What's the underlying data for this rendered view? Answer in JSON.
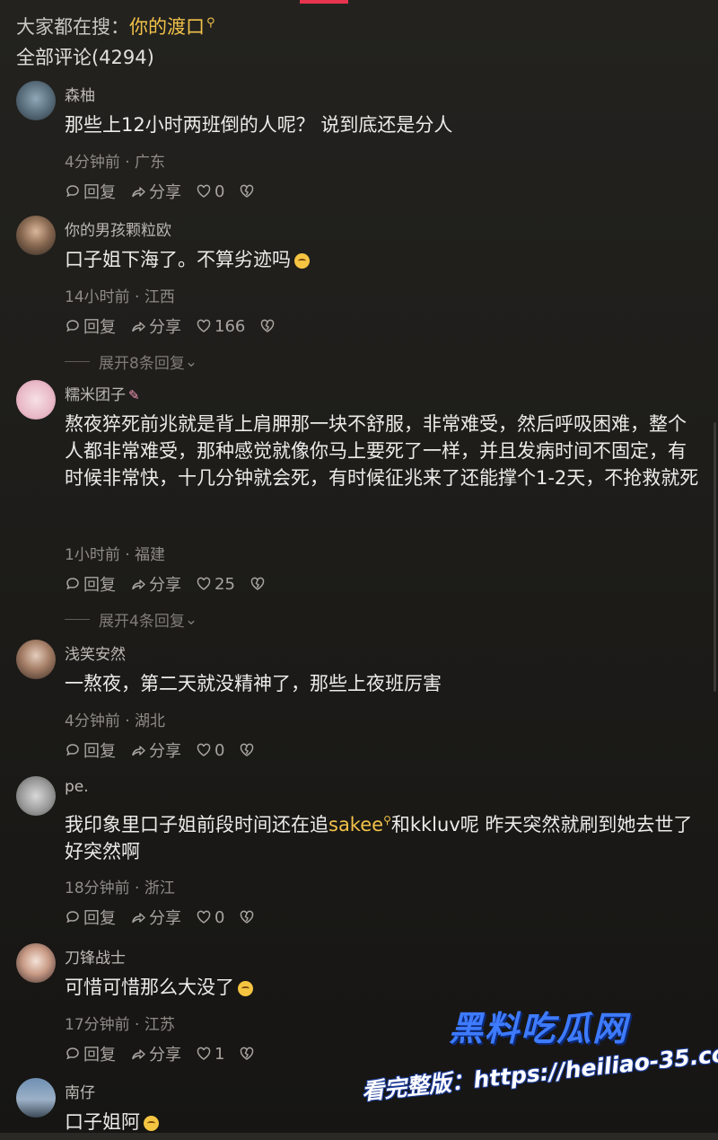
{
  "header": {
    "search_prefix": "大家都在搜：",
    "search_keyword": "你的渡口",
    "comment_count_label": "全部评论(4294)"
  },
  "labels": {
    "reply": "回复",
    "share": "分享"
  },
  "colors": {
    "accent": "#e8344e",
    "keyword": "#f2c249",
    "background": "#1b1a18"
  },
  "comments": [
    {
      "user": "森柚",
      "text": "那些上12小时两班倒的人呢？ 说到底还是分人",
      "meta": "4分钟前 · 广东",
      "likes": "0"
    },
    {
      "user": "你的男孩颗粒欧",
      "text": "口子姐下海了。不算劣迹吗",
      "meta": "14小时前 · 江西",
      "likes": "166",
      "expand": "展开8条回复"
    },
    {
      "user": "糯米团子",
      "text": "熬夜猝死前兆就是背上肩胛那一块不舒服，非常难受，然后呼吸困难，整个人都非常难受，那种感觉就像你马上要死了一样，并且发病时间不固定，有时候非常快，十几分钟就会死，有时候征兆来了还能撑个1-2天，不抢救就死",
      "meta": "1小时前 · 福建",
      "likes": "25",
      "expand": "展开4条回复"
    },
    {
      "user": "浅笑安然",
      "text": "一熬夜，第二天就没精神了，那些上夜班厉害",
      "meta": "4分钟前 · 湖北",
      "likes": "0"
    },
    {
      "user": "pe.",
      "text_before": "我印象里口子姐前段时间还在追",
      "link": "sakee",
      "text_after": "和kkluv呢 昨天突然就刷到她去世了 好突然啊",
      "meta": "18分钟前 · 浙江",
      "likes": "0"
    },
    {
      "user": "刀锋战士",
      "text": "可惜可惜那么大没了",
      "meta": "17分钟前 · 江苏",
      "likes": "1"
    },
    {
      "user": "南仔",
      "text": "口子姐阿"
    }
  ],
  "watermark": {
    "brand": "黑料吃瓜网",
    "url_line": "看完整版：https://heiliao-35.com"
  }
}
